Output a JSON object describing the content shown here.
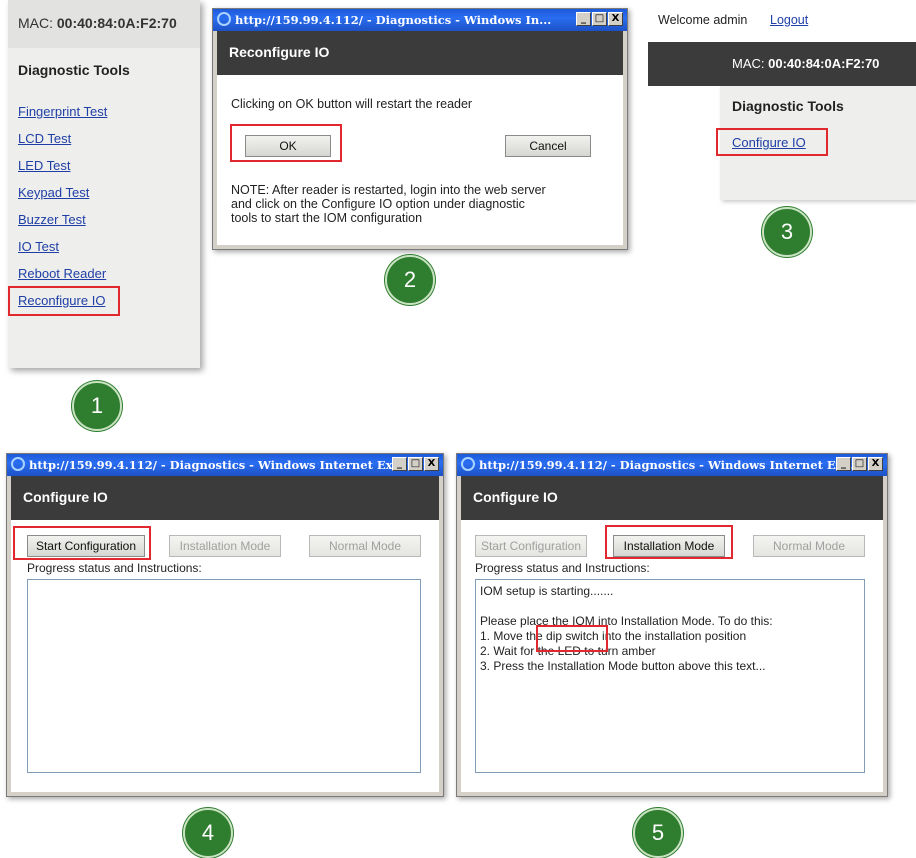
{
  "step_badges": [
    "1",
    "2",
    "3",
    "4",
    "5"
  ],
  "panel1": {
    "mac_label": "MAC:",
    "mac_value": "00:40:84:0A:F2:70",
    "section_title": "Diagnostic Tools",
    "links": [
      "Fingerprint Test",
      "LCD Test",
      "LED Test",
      "Keypad Test",
      "Buzzer Test",
      "IO Test",
      "Reboot Reader",
      "Reconfigure IO"
    ]
  },
  "panel2": {
    "window_title": "http://159.99.4.112/ - Diagnostics - Windows In...",
    "header": "Reconfigure IO",
    "message": "Clicking on OK button will restart the reader",
    "ok_label": "OK",
    "cancel_label": "Cancel",
    "note_lines": [
      "NOTE: After reader is restarted, login into the web server",
      "and click on the Configure IO option under diagnostic",
      "tools to start the IOM configuration"
    ]
  },
  "panel3": {
    "welcome": "Welcome admin",
    "logout": "Logout",
    "mac_label": "MAC:",
    "mac_value": "00:40:84:0A:F2:70",
    "section_title": "Diagnostic Tools",
    "link": "Configure IO"
  },
  "panel4": {
    "window_title": "http://159.99.4.112/ - Diagnostics - Windows Internet Ex...",
    "header": "Configure IO",
    "start_label": "Start Configuration",
    "install_label": "Installation Mode",
    "normal_label": "Normal Mode",
    "progress_label": "Progress status and Instructions:"
  },
  "panel5": {
    "window_title": "http://159.99.4.112/ - Diagnostics - Windows Internet Ex...",
    "header": "Configure IO",
    "start_label": "Start Configuration",
    "install_label": "Installation Mode",
    "normal_label": "Normal Mode",
    "progress_label": "Progress status and Instructions:",
    "status_lines": [
      "IOM setup is starting.......",
      "",
      "Please place the IOM into Installation Mode. To do this:",
      "1. Move the dip switch into the installation position",
      "2. Wait for the LED to turn amber",
      "3. Press the Installation Mode button above this text..."
    ],
    "highlight_text": "dip switch"
  },
  "window_buttons": {
    "minimize": "_",
    "maximize": "□",
    "close": "X"
  },
  "colors": {
    "highlight": "#e0282e",
    "badge": "#2f7d2f",
    "header": "#3b3b3b",
    "titlebar": "#2a6df1",
    "link": "#1f3fa6"
  }
}
